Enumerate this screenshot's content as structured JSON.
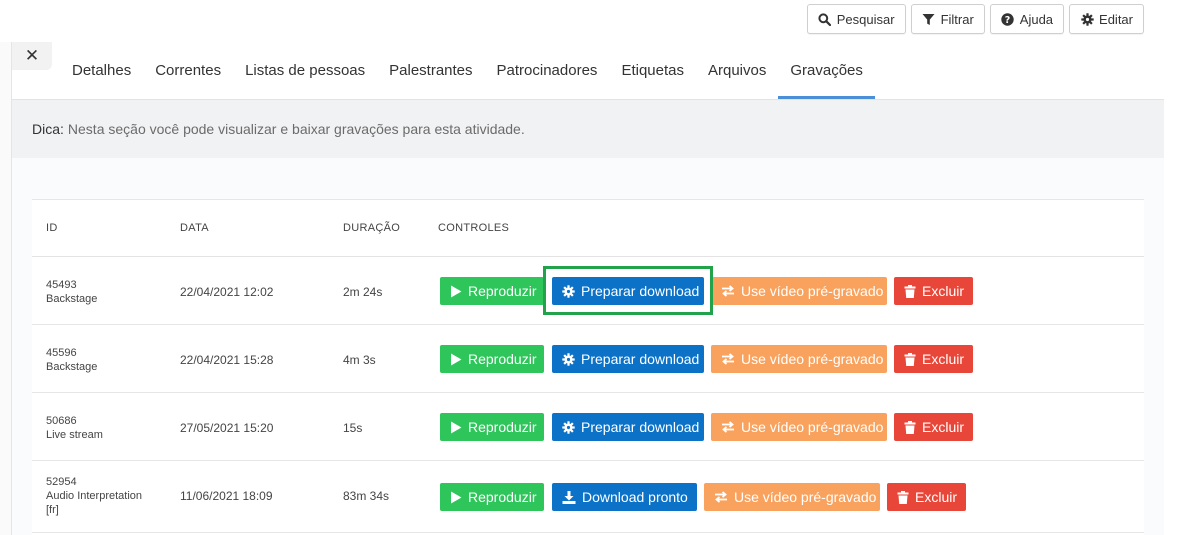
{
  "toolbar": {
    "search": {
      "label": "Pesquisar",
      "icon": "search-icon"
    },
    "filter": {
      "label": "Filtrar",
      "icon": "filter-icon"
    },
    "help": {
      "label": "Ajuda",
      "icon": "question-circle-icon"
    },
    "edit": {
      "label": "Editar",
      "icon": "gear-icon"
    }
  },
  "close": {
    "symbol": "✕",
    "icon": "close-icon"
  },
  "tabs": [
    {
      "label": "Detalhes"
    },
    {
      "label": "Correntes"
    },
    {
      "label": "Listas de pessoas"
    },
    {
      "label": "Palestrantes"
    },
    {
      "label": "Patrocinadores"
    },
    {
      "label": "Etiquetas"
    },
    {
      "label": "Arquivos"
    },
    {
      "label": "Gravações",
      "active": true
    }
  ],
  "tip": {
    "label": "Dica:",
    "text": "Nesta seção você pode visualizar e baixar gravações para esta atividade."
  },
  "table": {
    "headers": {
      "id": "ID",
      "date": "DATA",
      "duration": "DURAÇÃO",
      "controls": "CONTROLES"
    },
    "rows": [
      {
        "id": "45493",
        "type": "Backstage",
        "date": "22/04/2021 12:02",
        "duration": "2m 24s",
        "play": "Reproduzir",
        "download": "Preparar download",
        "download_icon": "gear-icon",
        "prerecorded": "Use vídeo pré-gravado",
        "delete": "Excluir"
      },
      {
        "id": "45596",
        "type": "Backstage",
        "date": "22/04/2021 15:28",
        "duration": "4m 3s",
        "play": "Reproduzir",
        "download": "Preparar download",
        "download_icon": "gear-icon",
        "prerecorded": "Use vídeo pré-gravado",
        "delete": "Excluir"
      },
      {
        "id": "50686",
        "type": "Live stream",
        "date": "27/05/2021 15:20",
        "duration": "15s",
        "play": "Reproduzir",
        "download": "Preparar download",
        "download_icon": "gear-icon",
        "prerecorded": "Use vídeo pré-gravado",
        "delete": "Excluir"
      },
      {
        "id": "52954",
        "type": "Audio Interpretation",
        "type2": "[fr]",
        "date": "11/06/2021 18:09",
        "duration": "83m 34s",
        "play": "Reproduzir",
        "download": "Download pronto",
        "download_icon": "download-icon",
        "prerecorded": "Use vídeo pré-gravado",
        "delete": "Excluir"
      }
    ]
  },
  "colors": {
    "green": "#2ec55a",
    "blue": "#0b72c8",
    "orange": "#f9a25e",
    "red": "#e84638",
    "tab_active": "#4a8fd8",
    "highlight": "#22a24a"
  }
}
